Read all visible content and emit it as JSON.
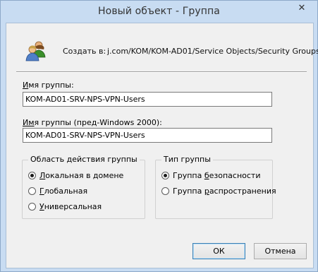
{
  "window": {
    "title": "Новый объект - Группа",
    "close_glyph": "✕"
  },
  "header": {
    "icon": "users-group-icon",
    "create_in_label": "Создать в:",
    "create_in_path": "j.com/KOM/KOM-AD01/Service Objects/Security Groups"
  },
  "group_name": {
    "label_prefix": "",
    "label_underlined": "И",
    "label_rest": "мя группы:",
    "value": "KOM-AD01-SRV-NPS-VPN-Users"
  },
  "group_name_pre2000": {
    "label_underlined": "Им",
    "label_rest": "я группы (пред-Windows 2000):",
    "value": "KOM-AD01-SRV-NPS-VPN-Users"
  },
  "scope": {
    "title": "Область действия группы",
    "options": [
      {
        "u": "Л",
        "rest": "окальная в домене",
        "checked": true
      },
      {
        "u": "Г",
        "rest": "лобальная",
        "checked": false
      },
      {
        "u": "У",
        "rest": "ниверсальная",
        "checked": false
      }
    ]
  },
  "type": {
    "title": "Тип группы",
    "options": [
      {
        "pre": "Группа ",
        "u": "б",
        "rest": "езопасности",
        "checked": true
      },
      {
        "pre": "Группа ",
        "u": "р",
        "rest": "аспространения",
        "checked": false
      }
    ]
  },
  "buttons": {
    "ok": "ОК",
    "cancel": "Отмена"
  }
}
